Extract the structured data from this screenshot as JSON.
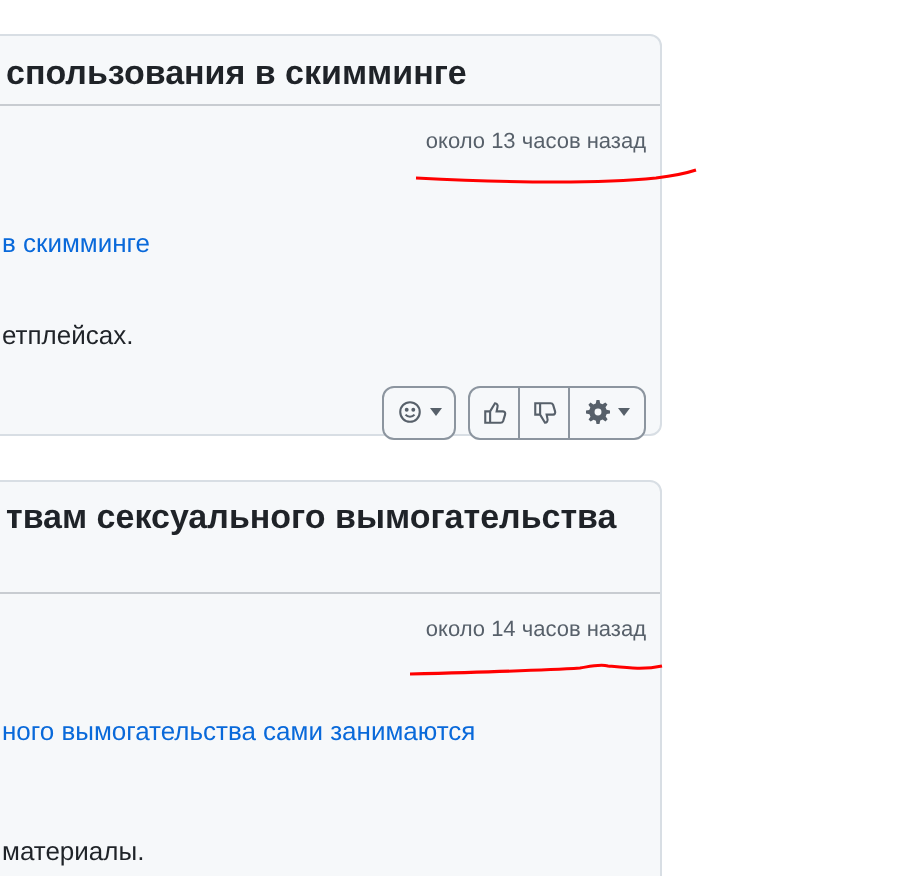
{
  "posts": [
    {
      "title": "спользования в скимминге",
      "time": "около 13 часов назад",
      "link": "в скимминге",
      "text": "етплейсах.",
      "actions": true
    },
    {
      "title": "твам сексуального вымогательства",
      "time": "около 14 часов назад",
      "link": "ного вымогательства сами занимаются",
      "text": "материалы."
    }
  ]
}
